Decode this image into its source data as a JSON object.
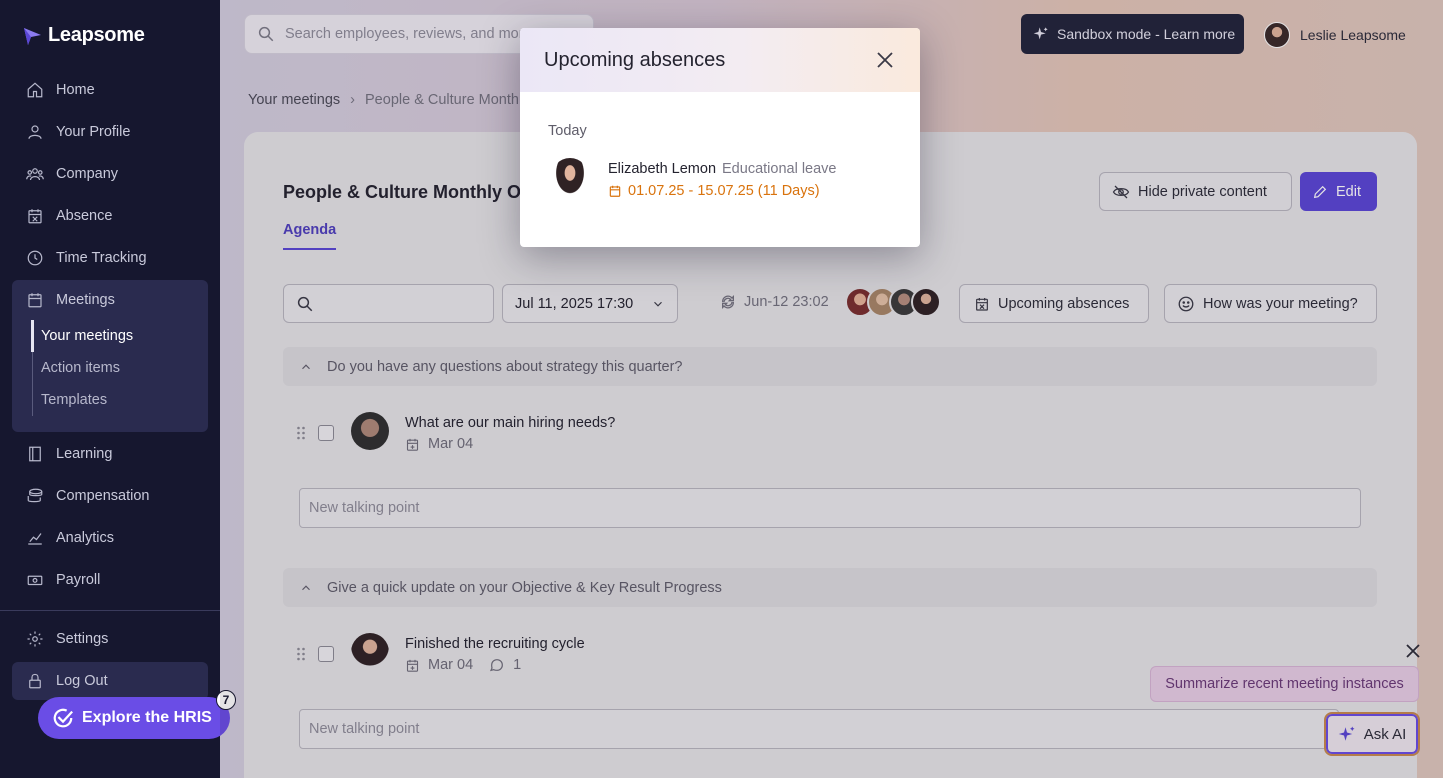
{
  "app": {
    "brand": "Leapsome"
  },
  "sidebar": {
    "items": [
      {
        "label": "Home",
        "icon": "home-icon"
      },
      {
        "label": "Your Profile",
        "icon": "user-icon"
      },
      {
        "label": "Company",
        "icon": "team-icon"
      },
      {
        "label": "Absence",
        "icon": "calendar-x-icon"
      },
      {
        "label": "Time Tracking",
        "icon": "clock-icon"
      },
      {
        "label": "Meetings",
        "icon": "calendar-icon"
      },
      {
        "label": "Learning",
        "icon": "book-icon"
      },
      {
        "label": "Compensation",
        "icon": "coins-icon"
      },
      {
        "label": "Analytics",
        "icon": "chart-icon"
      },
      {
        "label": "Payroll",
        "icon": "money-icon"
      }
    ],
    "meetings_sub": [
      "Your meetings",
      "Action items",
      "Templates"
    ],
    "settings": "Settings",
    "logout": "Log Out",
    "explore": {
      "label": "Explore the HRIS",
      "badge": "7"
    }
  },
  "header": {
    "search_placeholder": "Search employees, reviews, and more",
    "sandbox": "Sandbox mode - Learn more",
    "user_name": "Leslie Leapsome"
  },
  "breadcrumb": [
    "Your meetings",
    "People & Culture Monthly OKR"
  ],
  "meeting": {
    "title": "People & Culture Monthly OKR",
    "tab": "Agenda",
    "hide_private": "Hide private content",
    "edit": "Edit",
    "date_select": "Jul 11, 2025 17:30",
    "sync_time": "Jun-12 23:02",
    "upcoming_absences": "Upcoming absences",
    "how_was": "How was your meeting?"
  },
  "sections": [
    {
      "question": "Do you have any questions about strategy this quarter?",
      "item_title": "What are our main hiring needs?",
      "item_date": "Mar 04",
      "comments": ""
    },
    {
      "question": "Give a quick update on your Objective & Key Result Progress",
      "item_title": "Finished the recruiting cycle",
      "item_date": "Mar 04",
      "comments": "1"
    }
  ],
  "talking_point_placeholder": "New talking point",
  "ai": {
    "summarize": "Summarize recent meeting instances",
    "ask": "Ask AI"
  },
  "modal": {
    "title": "Upcoming absences",
    "section": "Today",
    "person": "Elizabeth Lemon",
    "type": "Educational leave",
    "dates": "01.07.25 - 15.07.25 (11 Days)"
  },
  "colors": {
    "sidebar_bg": "#16172f",
    "accent": "#5a46d6",
    "absence_date": "#d9730d"
  }
}
